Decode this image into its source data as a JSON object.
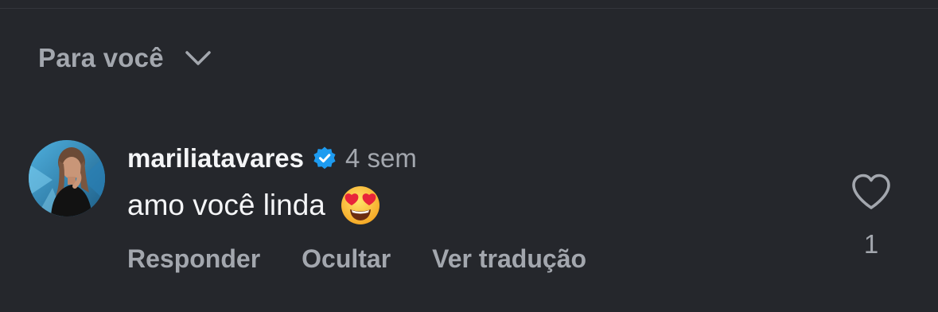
{
  "sort": {
    "label": "Para você",
    "icon": "chevron-down-icon"
  },
  "comment": {
    "avatar_icon": "avatar",
    "username": "mariliatavares",
    "verified_icon": "verified-badge-icon",
    "verified_color": "#1d9bf0",
    "timestamp": "4 sem",
    "text": "amo você linda",
    "emoji_icon": "heart-eyes-emoji-icon",
    "actions": {
      "reply": "Responder",
      "hide": "Ocultar",
      "translate": "Ver tradução"
    },
    "like": {
      "icon": "heart-outline-icon",
      "count": "1"
    }
  },
  "colors": {
    "background": "#25272c",
    "primary_text": "#f4f5f7",
    "secondary_text": "#a3a7ae"
  }
}
